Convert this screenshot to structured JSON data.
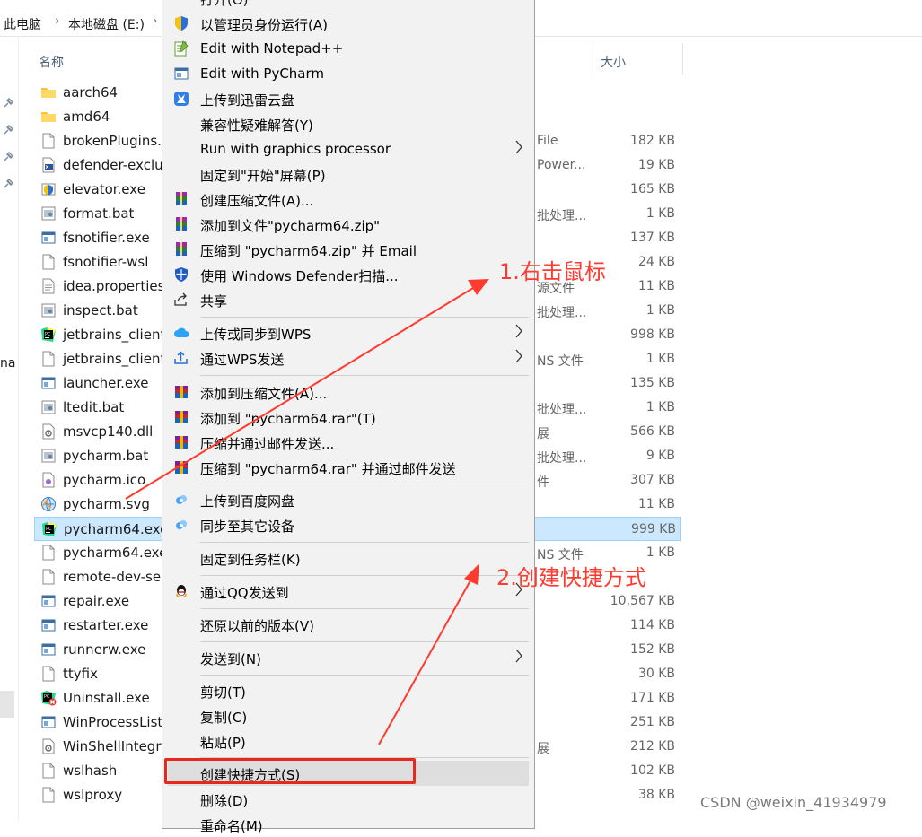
{
  "breadcrumb": [
    "此电脑",
    "本地磁盘 (E:)"
  ],
  "columns": {
    "name": "名称",
    "size": "大小"
  },
  "left_edge_text": "na",
  "files": [
    {
      "name": "aarch64",
      "type": "",
      "size": "",
      "icon": "folder-icon"
    },
    {
      "name": "amd64",
      "type": "",
      "size": "",
      "icon": "folder-icon"
    },
    {
      "name": "brokenPlugins.",
      "type": "File",
      "size": "182 KB",
      "icon": "file-icon"
    },
    {
      "name": "defender-exclu",
      "type": "Power...",
      "size": "19 KB",
      "icon": "powershell-icon"
    },
    {
      "name": "elevator.exe",
      "type": "",
      "size": "165 KB",
      "icon": "elevator-icon"
    },
    {
      "name": "format.bat",
      "type": "批处理...",
      "size": "1 KB",
      "icon": "bat-icon"
    },
    {
      "name": "fsnotifier.exe",
      "type": "",
      "size": "137 KB",
      "icon": "exe-icon"
    },
    {
      "name": "fsnotifier-wsl",
      "type": "",
      "size": "24 KB",
      "icon": "file-icon"
    },
    {
      "name": "idea.properties",
      "type": "源文件",
      "size": "11 KB",
      "icon": "text-file-icon"
    },
    {
      "name": "inspect.bat",
      "type": "批处理...",
      "size": "1 KB",
      "icon": "bat-icon"
    },
    {
      "name": "jetbrains_client",
      "type": "",
      "size": "998 KB",
      "icon": "pycharm-icon"
    },
    {
      "name": "jetbrains_client",
      "type": "NS 文件",
      "size": "1 KB",
      "icon": "file-icon"
    },
    {
      "name": "launcher.exe",
      "type": "",
      "size": "135 KB",
      "icon": "exe-icon"
    },
    {
      "name": "ltedit.bat",
      "type": "批处理...",
      "size": "1 KB",
      "icon": "bat-icon"
    },
    {
      "name": "msvcp140.dll",
      "type": "展",
      "size": "566 KB",
      "icon": "dll-icon"
    },
    {
      "name": "pycharm.bat",
      "type": "批处理...",
      "size": "9 KB",
      "icon": "bat-icon"
    },
    {
      "name": "pycharm.ico",
      "type": "件",
      "size": "307 KB",
      "icon": "ico-file-icon"
    },
    {
      "name": "pycharm.svg",
      "type": "",
      "size": "11 KB",
      "icon": "svg-file-icon"
    },
    {
      "name": "pycharm64.exe",
      "type": "",
      "size": "999 KB",
      "icon": "pycharm-icon",
      "selected": true
    },
    {
      "name": "pycharm64.exe",
      "type": "NS 文件",
      "size": "1 KB",
      "icon": "file-icon"
    },
    {
      "name": "remote-dev-se",
      "type": "",
      "size": "",
      "icon": "file-icon"
    },
    {
      "name": "repair.exe",
      "type": "",
      "size": "10,567 KB",
      "icon": "exe-icon"
    },
    {
      "name": "restarter.exe",
      "type": "",
      "size": "114 KB",
      "icon": "exe-icon"
    },
    {
      "name": "runnerw.exe",
      "type": "",
      "size": "152 KB",
      "icon": "exe-icon"
    },
    {
      "name": "ttyfix",
      "type": "",
      "size": "30 KB",
      "icon": "file-icon"
    },
    {
      "name": "Uninstall.exe",
      "type": "",
      "size": "171 KB",
      "icon": "uninstall-icon"
    },
    {
      "name": "WinProcessList",
      "type": "",
      "size": "251 KB",
      "icon": "exe-icon"
    },
    {
      "name": "WinShellIntegra",
      "type": "展",
      "size": "212 KB",
      "icon": "dll-icon"
    },
    {
      "name": "wslhash",
      "type": "",
      "size": "102 KB",
      "icon": "file-icon"
    },
    {
      "name": "wslproxy",
      "type": "",
      "size": "38 KB",
      "icon": "file-icon"
    }
  ],
  "context_menu": {
    "top_partial": "打开(O)",
    "items": [
      {
        "label": "以管理员身份运行(A)",
        "icon": "shield-icon"
      },
      {
        "label": "Edit with Notepad++",
        "icon": "notepad-plus-plus-icon"
      },
      {
        "label": "Edit with PyCharm",
        "icon": "pycharm-small-icon"
      },
      {
        "label": "上传到迅雷云盘",
        "icon": "xunlei-icon"
      },
      {
        "label": "兼容性疑难解答(Y)",
        "icon": ""
      },
      {
        "label": "Run with graphics processor",
        "icon": "",
        "submenu": true
      },
      {
        "label": "固定到\"开始\"屏幕(P)",
        "icon": ""
      },
      {
        "label": "创建压缩文件(A)...",
        "icon": "winrar-icon"
      },
      {
        "label": "添加到文件\"pycharm64.zip\"",
        "icon": "winrar-icon"
      },
      {
        "label": "压缩到 \"pycharm64.zip\" 并 Email",
        "icon": "winrar-icon"
      },
      {
        "label": "使用 Windows Defender扫描...",
        "icon": "defender-icon"
      },
      {
        "label": "共享",
        "icon": "share-icon"
      },
      {
        "label": "上传或同步到WPS",
        "icon": "wps-cloud-icon",
        "submenu": true
      },
      {
        "label": "通过WPS发送",
        "icon": "wps-send-icon",
        "submenu": true
      },
      {
        "label": "添加到压缩文件(A)...",
        "icon": "rar-icon"
      },
      {
        "label": "添加到 \"pycharm64.rar\"(T)",
        "icon": "rar-icon"
      },
      {
        "label": "压缩并通过邮件发送...",
        "icon": "rar-icon"
      },
      {
        "label": "压缩到 \"pycharm64.rar\" 并通过邮件发送",
        "icon": "rar-icon"
      },
      {
        "label": "上传到百度网盘",
        "icon": "baidu-netdisk-icon"
      },
      {
        "label": "同步至其它设备",
        "icon": "baidu-sync-icon"
      },
      {
        "label": "固定到任务栏(K)",
        "icon": ""
      },
      {
        "label": "通过QQ发送到",
        "icon": "qq-icon",
        "submenu": true
      },
      {
        "label": "还原以前的版本(V)",
        "icon": ""
      },
      {
        "label": "发送到(N)",
        "icon": "",
        "submenu": true
      },
      {
        "label": "剪切(T)",
        "icon": ""
      },
      {
        "label": "复制(C)",
        "icon": ""
      },
      {
        "label": "粘贴(P)",
        "icon": ""
      },
      {
        "label": "创建快捷方式(S)",
        "icon": "",
        "highlighted": true
      },
      {
        "label": "删除(D)",
        "icon": ""
      },
      {
        "label": "重命名(M)",
        "icon": ""
      }
    ]
  },
  "annotations": {
    "step1": "1.右击鼠标",
    "step2": "2.创建快捷方式",
    "color": "#ff3a2f"
  },
  "watermark": "CSDN @weixin_41934979"
}
